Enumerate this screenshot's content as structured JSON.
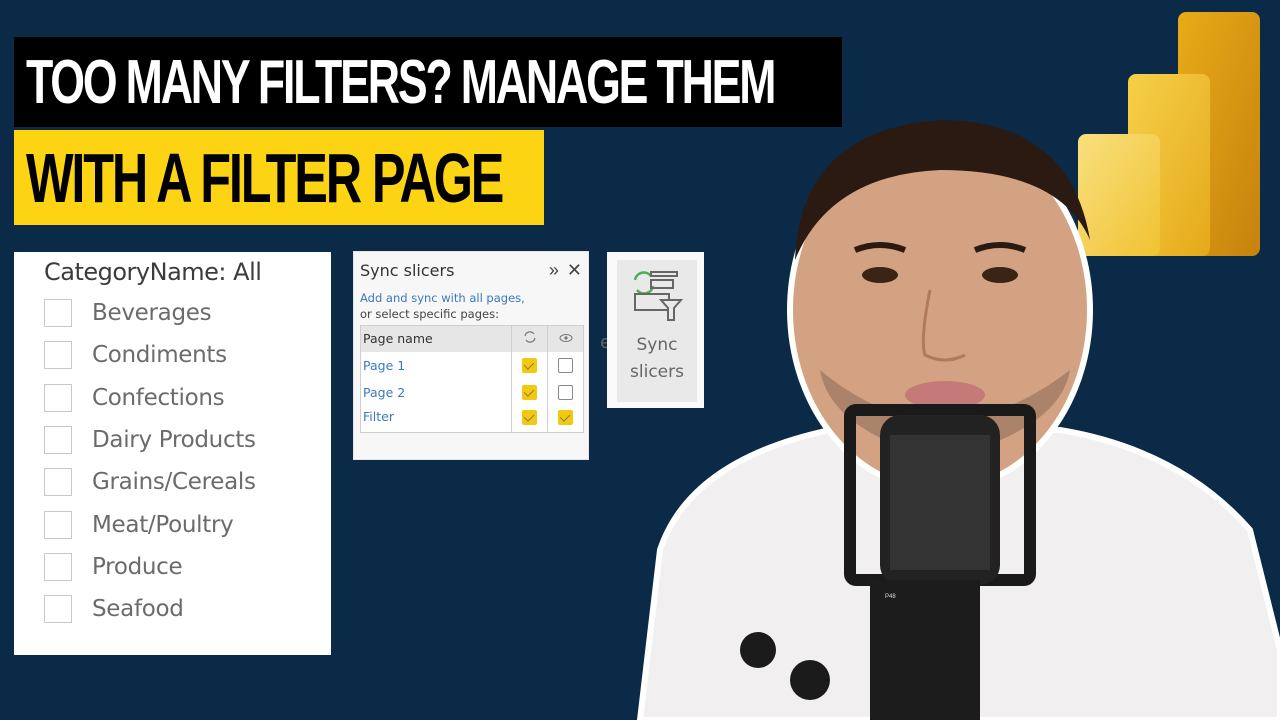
{
  "thumbnail": {
    "title_line_1": "TOO MANY FILTERS? MANAGE THEM",
    "title_line_2": "WITH A FILTER PAGE",
    "colors": {
      "background": "#0b2a48",
      "banner_black": "#000000",
      "banner_yellow": "#fdd414",
      "powerbi_yellow": "#f2c811"
    }
  },
  "slicer": {
    "title": "CategoryName: All",
    "items": [
      {
        "label": "Beverages",
        "checked": false
      },
      {
        "label": "Condiments",
        "checked": false
      },
      {
        "label": "Confections",
        "checked": false
      },
      {
        "label": "Dairy Products",
        "checked": false
      },
      {
        "label": "Grains/Cereals",
        "checked": false
      },
      {
        "label": "Meat/Poultry",
        "checked": false
      },
      {
        "label": "Produce",
        "checked": false
      },
      {
        "label": "Seafood",
        "checked": false
      }
    ]
  },
  "sync_pane": {
    "title": "Sync slicers",
    "expand_icon": "double-chevron-right-icon",
    "close_icon": "close-icon",
    "link_text": "Add and sync with all pages,",
    "description": "or select specific pages:",
    "table": {
      "header": {
        "page_name": "Page name",
        "sync_icon": "sync-icon",
        "visible_icon": "eye-icon"
      },
      "rows": [
        {
          "page": "Page 1",
          "sync": true,
          "visible": false
        },
        {
          "page": "Page 2",
          "sync": true,
          "visible": false
        },
        {
          "page": "Filter",
          "sync": true,
          "visible": true
        }
      ]
    }
  },
  "ribbon": {
    "partial_text": "e",
    "button_label_line1": "Sync",
    "button_label_line2": "slicers",
    "icon": "sync-slicers-icon"
  },
  "logo": {
    "name": "power-bi-logo"
  }
}
